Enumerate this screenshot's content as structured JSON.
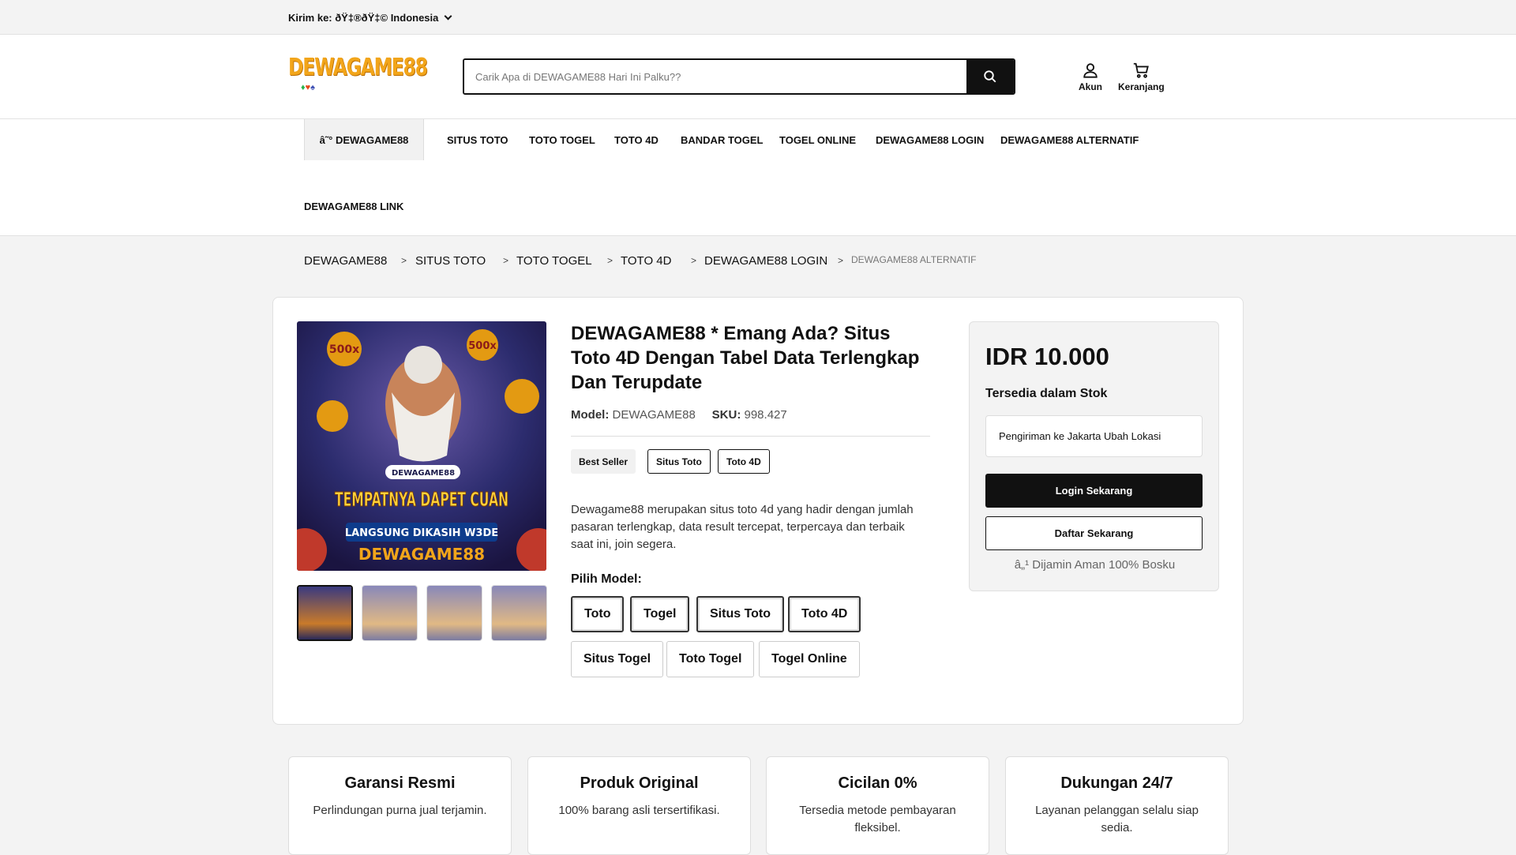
{
  "topbar": {
    "ship_to_label": "Kirim ke: ðŸ‡®ðŸ‡© Indonesia"
  },
  "header": {
    "logo_text": "DEWAGAME88",
    "logo_sub": [
      "♦",
      "♥",
      "♠"
    ],
    "search_placeholder": "Carik Apa di DEWAGAME88 Hari Ini Palku??",
    "account_label": "Akun",
    "cart_label": "Keranjang"
  },
  "nav": {
    "items": [
      "â˜° DEWAGAME88",
      "SITUS TOTO",
      "TOTO TOGEL",
      "TOTO 4D",
      "BANDAR TOGEL",
      "TOGEL ONLINE",
      "DEWAGAME88 LOGIN",
      "DEWAGAME88 ALTERNATIF",
      "DEWAGAME88 LINK"
    ]
  },
  "breadcrumb": {
    "items": [
      "DEWAGAME88",
      "SITUS TOTO",
      "TOTO TOGEL",
      "TOTO 4D",
      "DEWAGAME88 LOGIN",
      "DEWAGAME88 ALTERNATIF"
    ],
    "separator": ">"
  },
  "product": {
    "image_banner": "TEMPATNYA DAPET CUAN",
    "image_sub": "LANGSUNG DIKASIH W3DE",
    "image_brand": "DEWAGAME88",
    "image_badge": "500x",
    "title": "DEWAGAME88 * Emang Ada? Situs Toto 4D Dengan Tabel Data Terlengkap Dan Terupdate",
    "model_label": "Model:",
    "model_value": "DEWAGAME88",
    "sku_label": "SKU:",
    "sku_value": "998.427",
    "tags": [
      "Best Seller",
      "Situs Toto",
      "Toto 4D"
    ],
    "description": "Dewagame88 merupakan situs toto 4d yang hadir dengan jumlah pasaran terlengkap, data result tercepat, terpercaya dan terbaik saat ini, join segera.",
    "pick_model_label": "Pilih Model:",
    "models": [
      "Toto",
      "Togel",
      "Situs Toto",
      "Toto 4D",
      "Situs Togel",
      "Toto Togel",
      "Togel Online"
    ]
  },
  "price_box": {
    "price": "IDR 10.000",
    "stock": "Tersedia dalam Stok",
    "shipping": "Pengiriman ke Jakarta Ubah Lokasi",
    "login_button": "Login Sekarang",
    "register_button": "Daftar Sekarang",
    "guarantee": "â„¹ Dijamin Aman 100% Bosku"
  },
  "features": [
    {
      "title": "Garansi Resmi",
      "text": "Perlindungan purna jual terjamin."
    },
    {
      "title": "Produk Original",
      "text": "100% barang asli tersertifikasi."
    },
    {
      "title": "Cicilan 0%",
      "text": "Tersedia metode pembayaran fleksibel."
    },
    {
      "title": "Dukungan 24/7",
      "text": "Layanan pelanggan selalu siap sedia."
    }
  ],
  "colors": {
    "accent": "#111111",
    "logo": "#f2a51a",
    "page_bg": "#f3f3f3"
  }
}
